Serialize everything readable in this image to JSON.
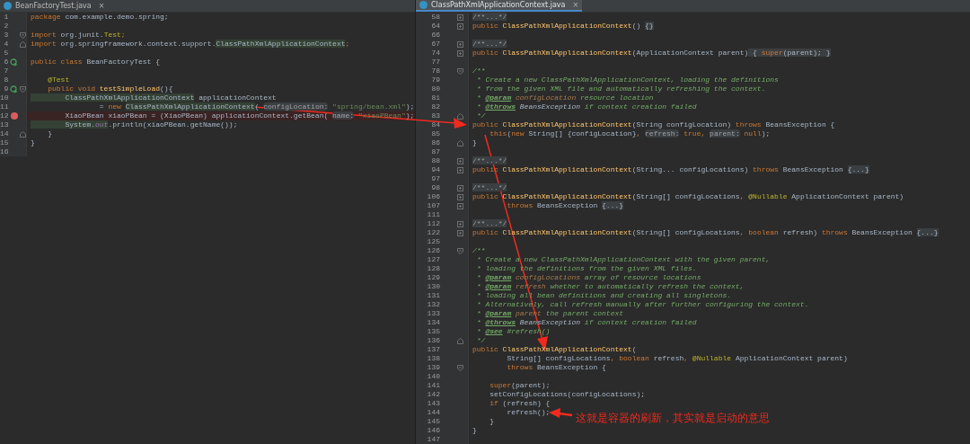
{
  "panes": [
    {
      "tab": {
        "title": "BeanFactoryTest.java",
        "close": "×",
        "selected": false
      },
      "lines": [
        {
          "number": "1",
          "tokens": [
            {
              "kind": "kw",
              "text": "package"
            },
            {
              "kind": "plain",
              "text": " com.example.demo.spring;"
            }
          ]
        },
        {
          "number": "2"
        },
        {
          "number": "3",
          "gutter": [
            {
              "kind": "collapse"
            }
          ],
          "tokens": [
            {
              "kind": "kw",
              "text": "import"
            },
            {
              "kind": "plain",
              "text": " org.junit."
            },
            {
              "kind": "ann",
              "text": "Test"
            },
            {
              "kind": "kw",
              "text": ";"
            }
          ]
        },
        {
          "number": "4",
          "gutter": [
            {
              "kind": "end"
            }
          ],
          "tokens": [
            {
              "kind": "kw",
              "text": "import"
            },
            {
              "kind": "plain",
              "text": " org.springframework.context.support."
            },
            {
              "kind": "usage",
              "text": "ClassPathXmlApplicationContext"
            },
            {
              "kind": "kw",
              "text": ";"
            }
          ]
        },
        {
          "number": "5"
        },
        {
          "number": "6",
          "gutter": [
            {
              "kind": "run"
            }
          ],
          "tokens": [
            {
              "kind": "kw",
              "text": "public class"
            },
            {
              "kind": "plain",
              "text": " BeanFactoryTest {"
            }
          ]
        },
        {
          "number": "7"
        },
        {
          "number": "8",
          "tokens": [
            {
              "kind": "ann",
              "text": "    @Test"
            }
          ]
        },
        {
          "number": "9",
          "gutter": [
            {
              "kind": "run"
            },
            {
              "kind": "collapse"
            }
          ],
          "tokens": [
            {
              "kind": "kw",
              "text": "    public void "
            },
            {
              "kind": "method",
              "text": "testSimpleLoad"
            },
            {
              "kind": "plain",
              "text": "(){"
            }
          ]
        },
        {
          "number": "10",
          "tokens": [
            {
              "kind": "usage",
              "text": "        ClassPathXmlApplicationContext"
            },
            {
              "kind": "plain",
              "text": " applicationContext"
            }
          ]
        },
        {
          "number": "11",
          "tokens": [
            {
              "kind": "plain",
              "text": "                = "
            },
            {
              "kind": "kw",
              "text": "new "
            },
            {
              "kind": "usage",
              "text": "ClassPathXmlApplicationContext"
            },
            {
              "kind": "plain",
              "text": "( "
            },
            {
              "kind": "hint",
              "text": "configLocation:"
            },
            {
              "kind": "str",
              "text": " \"spring/bean.xml\""
            },
            {
              "kind": "plain",
              "text": ");"
            }
          ]
        },
        {
          "number": "12",
          "gutter": [
            {
              "kind": "breakpoint"
            }
          ],
          "tokens": [
            {
              "kind": "plain",
              "text": "        XiaoPBean xiaoPBean = (XiaoPBean) applicationContext.getBean( "
            },
            {
              "kind": "hint",
              "text": "name:"
            },
            {
              "kind": "str",
              "text": " \"xiaoPBean\""
            },
            {
              "kind": "plain",
              "text": ");"
            }
          ]
        },
        {
          "number": "13",
          "tokens": [
            {
              "kind": "usage",
              "text": "        System."
            },
            {
              "kind": "field",
              "text": "out"
            },
            {
              "kind": "plain",
              "text": ".println(xiaoPBean.getName());"
            }
          ]
        },
        {
          "number": "14",
          "gutter": [
            {
              "kind": "end"
            }
          ],
          "tokens": [
            {
              "kind": "plain",
              "text": "    }"
            }
          ]
        },
        {
          "number": "15",
          "tokens": [
            {
              "kind": "plain",
              "text": "}"
            }
          ]
        },
        {
          "number": "16"
        }
      ]
    },
    {
      "tab": {
        "title": "ClassPathXmlApplicationContext.java",
        "close": "×",
        "selected": true
      },
      "lines": [
        {
          "number": "58",
          "gutter": [
            {
              "kind": "expand"
            }
          ],
          "tokens": [
            {
              "kind": "foldc",
              "text": "/**...*/"
            }
          ]
        },
        {
          "number": "64",
          "gutter": [
            {
              "kind": "expand"
            }
          ],
          "tokens": [
            {
              "kind": "kw",
              "text": "public "
            },
            {
              "kind": "method",
              "text": "ClassPathXmlApplicationContext"
            },
            {
              "kind": "plain",
              "text": "() "
            },
            {
              "kind": "fold",
              "text": "{}"
            }
          ]
        },
        {
          "number": "66"
        },
        {
          "number": "67",
          "gutter": [
            {
              "kind": "expand"
            }
          ],
          "tokens": [
            {
              "kind": "foldc",
              "text": "/**...*/"
            }
          ]
        },
        {
          "number": "74",
          "gutter": [
            {
              "kind": "expand"
            }
          ],
          "tokens": [
            {
              "kind": "kw",
              "text": "public "
            },
            {
              "kind": "method",
              "text": "ClassPathXmlApplicationContext"
            },
            {
              "kind": "plain",
              "text": "(ApplicationContext parent)"
            },
            {
              "kind": "fold",
              "text": " { "
            },
            {
              "kind": "foldkw",
              "text": "super"
            },
            {
              "kind": "fold",
              "text": "(parent); }"
            }
          ]
        },
        {
          "number": "77"
        },
        {
          "number": "78",
          "gutter": [
            {
              "kind": "collapse"
            }
          ],
          "tokens": [
            {
              "kind": "doc",
              "text": "/**"
            }
          ]
        },
        {
          "number": "79",
          "tokens": [
            {
              "kind": "doc",
              "text": " * Create a new ClassPathXmlApplicationContext, loading the definitions"
            }
          ]
        },
        {
          "number": "80",
          "tokens": [
            {
              "kind": "doc",
              "text": " * from the given XML file and automatically refreshing the context."
            }
          ]
        },
        {
          "number": "81",
          "tokens": [
            {
              "kind": "doc",
              "text": " * "
            },
            {
              "kind": "doctag",
              "text": "@param"
            },
            {
              "kind": "docparam",
              "text": " configLocation"
            },
            {
              "kind": "doc",
              "text": " resource location"
            }
          ]
        },
        {
          "number": "82",
          "tokens": [
            {
              "kind": "doc",
              "text": " * "
            },
            {
              "kind": "doctag",
              "text": "@throws"
            },
            {
              "kind": "docref",
              "text": " BeansException"
            },
            {
              "kind": "doc",
              "text": " if context creation failed"
            }
          ]
        },
        {
          "number": "83",
          "gutter": [
            {
              "kind": "end"
            }
          ],
          "tokens": [
            {
              "kind": "doc",
              "text": " */"
            }
          ]
        },
        {
          "number": "84",
          "tokens": [
            {
              "kind": "kw",
              "text": "public "
            },
            {
              "kind": "method",
              "text": "ClassPathXmlApplicationContext"
            },
            {
              "kind": "plain",
              "text": "(String configLocation) "
            },
            {
              "kind": "kw",
              "text": "throws"
            },
            {
              "kind": "plain",
              "text": " BeansException {"
            }
          ]
        },
        {
          "number": "85",
          "tokens": [
            {
              "kind": "kw",
              "text": "    this"
            },
            {
              "kind": "plain",
              "text": "("
            },
            {
              "kind": "kw",
              "text": "new"
            },
            {
              "kind": "plain",
              "text": " String[] {configLocation}"
            },
            {
              "kind": "kw",
              "text": ", "
            },
            {
              "kind": "hint",
              "text": "refresh:"
            },
            {
              "kind": "kw",
              "text": " true, "
            },
            {
              "kind": "hint",
              "text": "parent:"
            },
            {
              "kind": "kw",
              "text": " null"
            },
            {
              "kind": "plain",
              "text": ");"
            }
          ]
        },
        {
          "number": "86",
          "gutter": [
            {
              "kind": "end"
            }
          ],
          "tokens": [
            {
              "kind": "plain",
              "text": "}"
            }
          ]
        },
        {
          "number": "87"
        },
        {
          "number": "88",
          "gutter": [
            {
              "kind": "expand"
            }
          ],
          "tokens": [
            {
              "kind": "foldc",
              "text": "/**...*/"
            }
          ]
        },
        {
          "number": "94",
          "gutter": [
            {
              "kind": "expand"
            }
          ],
          "tokens": [
            {
              "kind": "kw",
              "text": "public "
            },
            {
              "kind": "method",
              "text": "ClassPathXmlApplicationContext"
            },
            {
              "kind": "plain",
              "text": "(String... configLocations) "
            },
            {
              "kind": "kw",
              "text": "throws"
            },
            {
              "kind": "plain",
              "text": " BeansException "
            },
            {
              "kind": "fold",
              "text": "{...}"
            }
          ]
        },
        {
          "number": "97"
        },
        {
          "number": "98",
          "gutter": [
            {
              "kind": "expand"
            }
          ],
          "tokens": [
            {
              "kind": "foldc",
              "text": "/**...*/"
            }
          ]
        },
        {
          "number": "106",
          "gutter": [
            {
              "kind": "expand"
            }
          ],
          "tokens": [
            {
              "kind": "kw",
              "text": "public "
            },
            {
              "kind": "method",
              "text": "ClassPathXmlApplicationContext"
            },
            {
              "kind": "plain",
              "text": "(String[] configLocations"
            },
            {
              "kind": "kw",
              "text": ", "
            },
            {
              "kind": "ann",
              "text": "@Nullable"
            },
            {
              "kind": "plain",
              "text": " ApplicationContext parent)"
            }
          ]
        },
        {
          "number": "107",
          "gutter": [
            {
              "kind": "expand"
            }
          ],
          "tokens": [
            {
              "kind": "kw",
              "text": "        throws"
            },
            {
              "kind": "plain",
              "text": " BeansException "
            },
            {
              "kind": "fold",
              "text": "{...}"
            }
          ]
        },
        {
          "number": "111"
        },
        {
          "number": "112",
          "gutter": [
            {
              "kind": "expand"
            }
          ],
          "tokens": [
            {
              "kind": "foldc",
              "text": "/**...*/"
            }
          ]
        },
        {
          "number": "122",
          "gutter": [
            {
              "kind": "expand"
            }
          ],
          "tokens": [
            {
              "kind": "kw",
              "text": "public "
            },
            {
              "kind": "method",
              "text": "ClassPathXmlApplicationContext"
            },
            {
              "kind": "plain",
              "text": "(String[] configLocations"
            },
            {
              "kind": "kw",
              "text": ", boolean"
            },
            {
              "kind": "plain",
              "text": " refresh) "
            },
            {
              "kind": "kw",
              "text": "throws"
            },
            {
              "kind": "plain",
              "text": " BeansException "
            },
            {
              "kind": "fold",
              "text": "{...}"
            }
          ]
        },
        {
          "number": "125"
        },
        {
          "number": "126",
          "gutter": [
            {
              "kind": "collapse"
            }
          ],
          "tokens": [
            {
              "kind": "doc",
              "text": "/**"
            }
          ]
        },
        {
          "number": "127",
          "tokens": [
            {
              "kind": "doc",
              "text": " * Create a new ClassPathXmlApplicationContext with the given parent,"
            }
          ]
        },
        {
          "number": "128",
          "tokens": [
            {
              "kind": "doc",
              "text": " * loading the definitions from the given XML files."
            }
          ]
        },
        {
          "number": "129",
          "tokens": [
            {
              "kind": "doc",
              "text": " * "
            },
            {
              "kind": "doctag",
              "text": "@param"
            },
            {
              "kind": "docparam",
              "text": " configLocations"
            },
            {
              "kind": "doc",
              "text": " array of resource locations"
            }
          ]
        },
        {
          "number": "130",
          "tokens": [
            {
              "kind": "doc",
              "text": " * "
            },
            {
              "kind": "doctag",
              "text": "@param"
            },
            {
              "kind": "docparam",
              "text": " refresh"
            },
            {
              "kind": "doc",
              "text": " whether to automatically refresh the context,"
            }
          ]
        },
        {
          "number": "131",
          "tokens": [
            {
              "kind": "doc",
              "text": " * loading all bean definitions and creating all singletons."
            }
          ]
        },
        {
          "number": "132",
          "tokens": [
            {
              "kind": "doc",
              "text": " * Alternatively, call refresh manually after further configuring the context."
            }
          ]
        },
        {
          "number": "133",
          "tokens": [
            {
              "kind": "doc",
              "text": " * "
            },
            {
              "kind": "doctag",
              "text": "@param"
            },
            {
              "kind": "docparam",
              "text": " parent"
            },
            {
              "kind": "doc",
              "text": " the parent context"
            }
          ]
        },
        {
          "number": "134",
          "tokens": [
            {
              "kind": "doc",
              "text": " * "
            },
            {
              "kind": "doctag",
              "text": "@throws"
            },
            {
              "kind": "docref",
              "text": " BeansException"
            },
            {
              "kind": "doc",
              "text": " if context creation failed"
            }
          ]
        },
        {
          "number": "135",
          "tokens": [
            {
              "kind": "doc",
              "text": " * "
            },
            {
              "kind": "doctag",
              "text": "@see"
            },
            {
              "kind": "doc",
              "text": " #refresh()"
            }
          ]
        },
        {
          "number": "136",
          "gutter": [
            {
              "kind": "end"
            }
          ],
          "tokens": [
            {
              "kind": "doc",
              "text": " */"
            }
          ]
        },
        {
          "number": "137",
          "tokens": [
            {
              "kind": "kw",
              "text": "public "
            },
            {
              "kind": "method",
              "text": "ClassPathXmlApplicationContext"
            },
            {
              "kind": "plain",
              "text": "("
            }
          ]
        },
        {
          "number": "138",
          "tokens": [
            {
              "kind": "plain",
              "text": "        String[] configLocations"
            },
            {
              "kind": "kw",
              "text": ", boolean"
            },
            {
              "kind": "plain",
              "text": " refresh"
            },
            {
              "kind": "kw",
              "text": ", "
            },
            {
              "kind": "ann",
              "text": "@Nullable"
            },
            {
              "kind": "plain",
              "text": " ApplicationContext parent)"
            }
          ]
        },
        {
          "number": "139",
          "gutter": [
            {
              "kind": "collapse"
            }
          ],
          "tokens": [
            {
              "kind": "kw",
              "text": "        throws"
            },
            {
              "kind": "plain",
              "text": " BeansException {"
            }
          ]
        },
        {
          "number": "140"
        },
        {
          "number": "141",
          "tokens": [
            {
              "kind": "kw",
              "text": "    super"
            },
            {
              "kind": "plain",
              "text": "(parent);"
            }
          ]
        },
        {
          "number": "142",
          "tokens": [
            {
              "kind": "plain",
              "text": "    setConfigLocations(configLocations);"
            }
          ]
        },
        {
          "number": "143",
          "tokens": [
            {
              "kind": "kw",
              "text": "    if"
            },
            {
              "kind": "plain",
              "text": " (refresh) {"
            }
          ]
        },
        {
          "number": "144",
          "tokens": [
            {
              "kind": "plain",
              "text": "        refresh();"
            }
          ]
        },
        {
          "number": "145",
          "tokens": [
            {
              "kind": "plain",
              "text": "    }"
            }
          ]
        },
        {
          "number": "146",
          "tokens": [
            {
              "kind": "plain",
              "text": "}"
            }
          ]
        },
        {
          "number": "147"
        }
      ]
    }
  ],
  "annotation": {
    "note": "这就是容器的刷新，其实就是启动的意思"
  }
}
